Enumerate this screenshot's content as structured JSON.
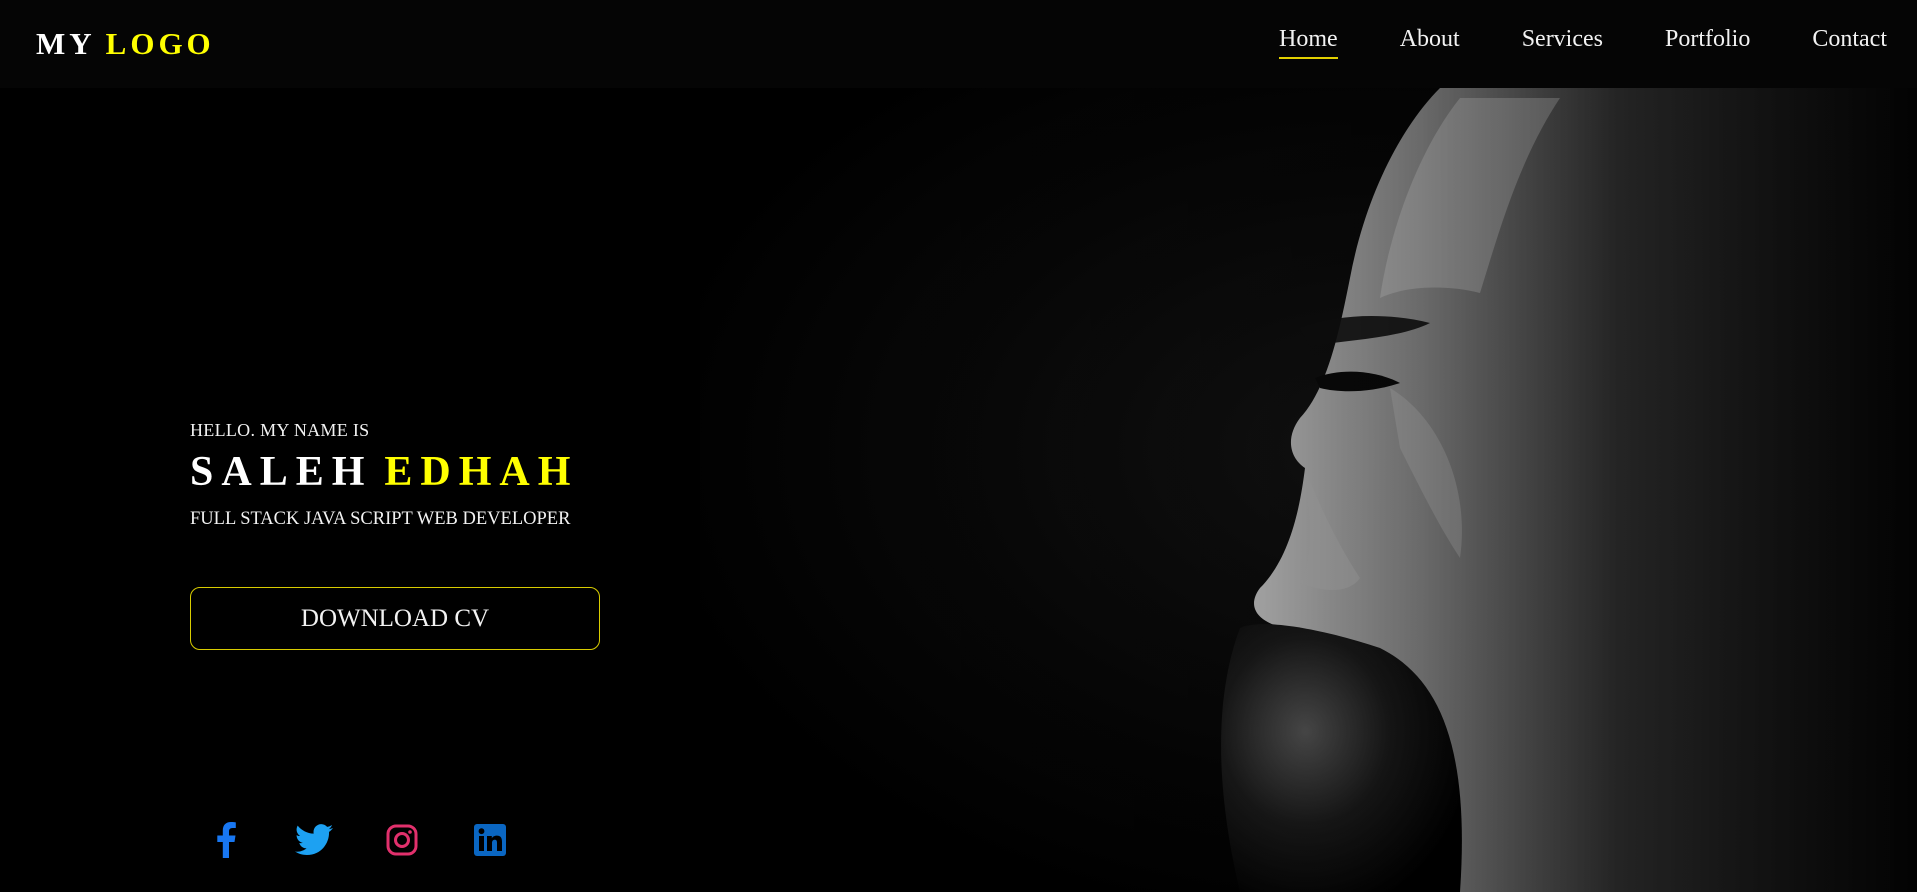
{
  "nav": {
    "logo_first": "MY",
    "logo_second": "LOGO",
    "items": [
      {
        "label": "Home",
        "active": true
      },
      {
        "label": "About",
        "active": false
      },
      {
        "label": "Services",
        "active": false
      },
      {
        "label": "Portfolio",
        "active": false
      },
      {
        "label": "Contact",
        "active": false
      }
    ]
  },
  "hero": {
    "greeting": "HELLO. MY NAME IS",
    "first_name": "SALEH",
    "last_name": "EDHAH",
    "role": "FULL STACK JAVA SCRIPT WEB DEVELOPER",
    "cta_label": "DOWNLOAD CV"
  },
  "socials": [
    {
      "icon": "facebook-icon",
      "color": "#1877f2"
    },
    {
      "icon": "twitter-icon",
      "color": "#1da1f2"
    },
    {
      "icon": "instagram-icon",
      "color": "#e1306c"
    },
    {
      "icon": "linkedin-icon",
      "color": "#0a66c2"
    }
  ],
  "colors": {
    "background": "#000000",
    "accent": "#ffff00",
    "text": "#f2f2f2"
  }
}
